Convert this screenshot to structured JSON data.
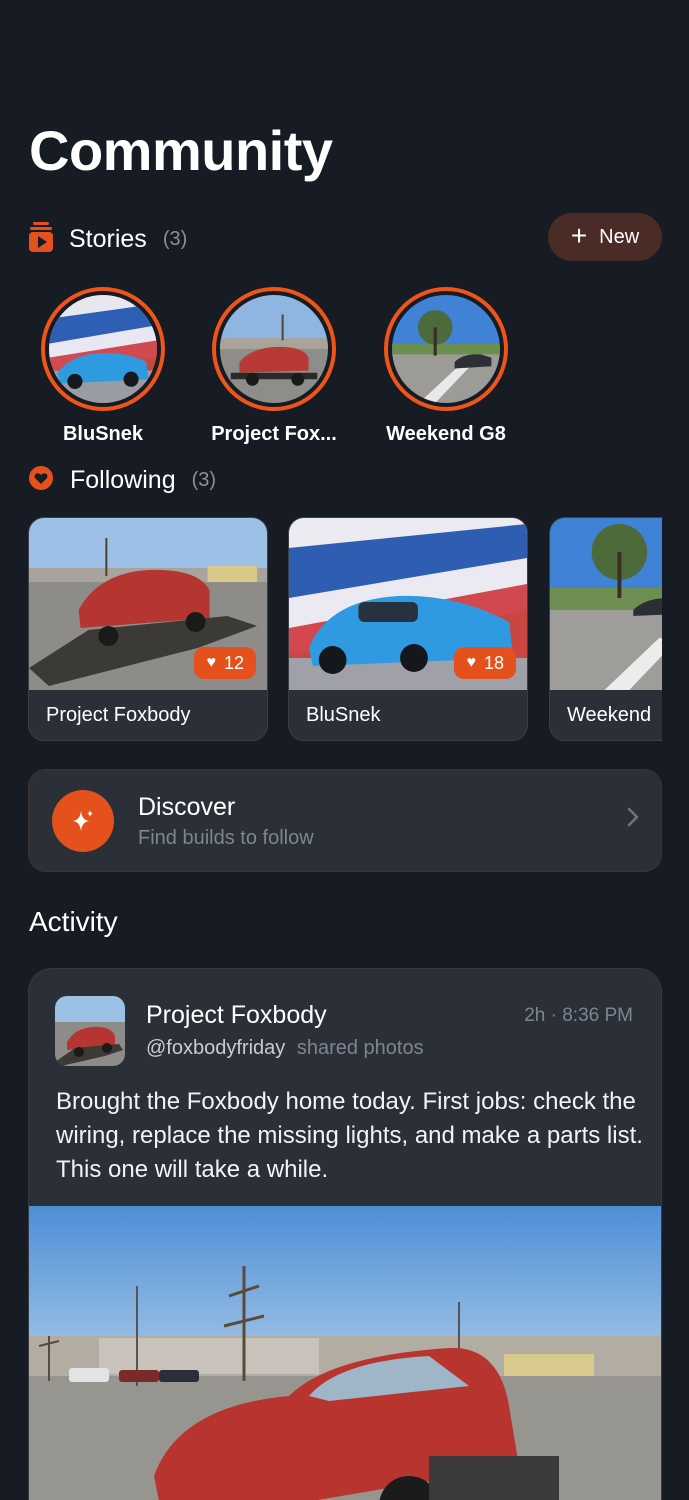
{
  "page": {
    "title": "Community"
  },
  "stories": {
    "label": "Stories",
    "count": "(3)",
    "new_button": "New",
    "items": [
      {
        "name": "BluSnek"
      },
      {
        "name": "Project Fox..."
      },
      {
        "name": "Weekend G8"
      }
    ]
  },
  "following": {
    "label": "Following",
    "count": "(3)",
    "cards": [
      {
        "title": "Project Foxbody",
        "likes": "12"
      },
      {
        "title": "BluSnek",
        "likes": "18"
      },
      {
        "title": "Weekend"
      }
    ]
  },
  "discover": {
    "title": "Discover",
    "subtitle": "Find builds to follow"
  },
  "activity": {
    "title": "Activity",
    "post": {
      "name": "Project Foxbody",
      "handle": "@foxbodyfriday",
      "action": "shared photos",
      "time": "2h · 8:36 PM",
      "text": "Brought the Foxbody home today. First jobs: check the wiring, replace the missing lights, and make a parts list. This one will take a while."
    }
  },
  "colors": {
    "background": "#171c24",
    "card": "#2a2f38",
    "accent": "#e4511d",
    "ring": "#ef5418"
  },
  "icons": {
    "stories": "stories-icon",
    "following": "heart-icon",
    "discover": "sparkle-icon",
    "chevron": "chevron-right-icon",
    "new": "plus-icon"
  }
}
